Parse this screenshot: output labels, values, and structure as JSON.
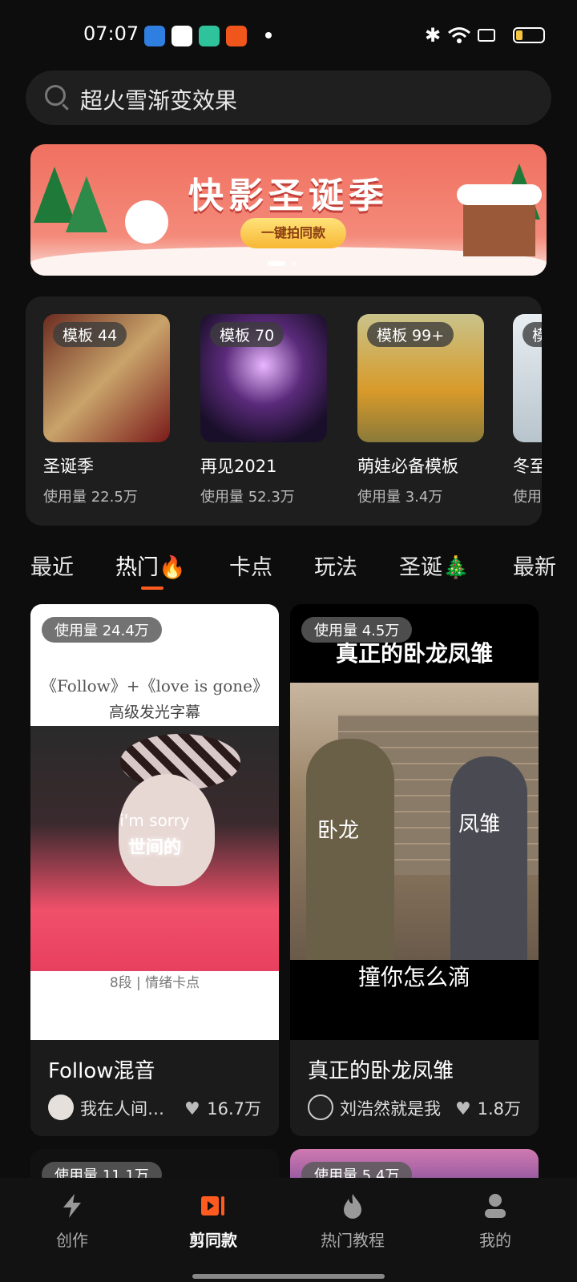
{
  "status": {
    "time": "07:07"
  },
  "search": {
    "query": "超火雪渐变效果"
  },
  "banner": {
    "title": "快影圣诞季",
    "cta": "一键拍同款"
  },
  "templates": [
    {
      "badge": "模板 44",
      "name": "圣诞季",
      "usage": "使用量 22.5万"
    },
    {
      "badge": "模板 70",
      "name": "再见2021",
      "usage": "使用量 52.3万"
    },
    {
      "badge": "模板 99+",
      "name": "萌娃必备模板",
      "usage": "使用量 3.4万"
    },
    {
      "badge": "模",
      "name": "冬至",
      "usage": "使用"
    }
  ],
  "tabs": [
    "最近",
    "热门🔥",
    "卡点",
    "玩法",
    "圣诞🎄",
    "最新"
  ],
  "active_tab": "热门🔥",
  "cards": [
    {
      "usage": "使用量 24.4万",
      "overlay_top": "《Follow》+《love is gone》",
      "overlay_sub": "高级发光字幕",
      "overlay_mid1": "i'm sorry",
      "overlay_mid2": "世间的",
      "overlay_bottom": "8段 | 情绪卡点",
      "title": "Follow混音",
      "author": "我在人间…",
      "likes": "16.7万"
    },
    {
      "usage": "使用量 4.5万",
      "overlay_top": "真正的卧龙凤雏",
      "label_left": "卧龙",
      "label_right": "凤雏",
      "overlay_bottom": "撞你怎么滴",
      "title": "真正的卧龙凤雏",
      "author": "刘浩然就是我",
      "likes": "1.8万"
    }
  ],
  "partial_cards": [
    {
      "usage": "使用量 11.1万"
    },
    {
      "usage": "使用量 5.4万"
    }
  ],
  "nav": [
    {
      "label": "创作",
      "icon": "lightning-icon"
    },
    {
      "label": "剪同款",
      "icon": "video-template-icon"
    },
    {
      "label": "热门教程",
      "icon": "flame-icon"
    },
    {
      "label": "我的",
      "icon": "profile-icon"
    }
  ],
  "active_nav": "剪同款",
  "colors": {
    "accent": "#ff5a1f",
    "background": "#0d0d0d",
    "card": "#1b1b1b"
  }
}
